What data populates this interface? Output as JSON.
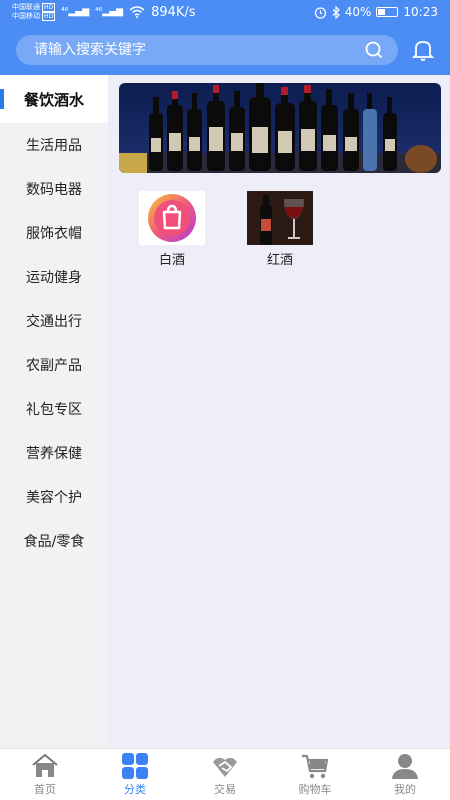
{
  "status": {
    "carrier1": "中国联通",
    "carrier2": "中国移动",
    "hd": "HD",
    "net1": "⁴⁶",
    "net2": "⁴⁶",
    "speed": "894K/s",
    "battery": "40%",
    "battery_level": 0.4,
    "time": "10:23"
  },
  "search": {
    "placeholder": "请输入搜索关键字"
  },
  "sidebar": {
    "items": [
      {
        "label": "餐饮酒水",
        "active": true
      },
      {
        "label": "生活用品"
      },
      {
        "label": "数码电器"
      },
      {
        "label": "服饰衣帽"
      },
      {
        "label": "运动健身"
      },
      {
        "label": "交通出行"
      },
      {
        "label": "农副产品"
      },
      {
        "label": "礼包专区"
      },
      {
        "label": "营养保健"
      },
      {
        "label": "美容个护"
      },
      {
        "label": "食品/零食"
      }
    ]
  },
  "subcategories": [
    {
      "label": "白酒",
      "icon": "shopping-bag-logo-icon"
    },
    {
      "label": "红酒",
      "icon": "red-wine-glass-icon"
    }
  ],
  "tabbar": {
    "items": [
      {
        "label": "首页",
        "icon": "home-icon"
      },
      {
        "label": "分类",
        "icon": "grid-icon",
        "active": true
      },
      {
        "label": "交易",
        "icon": "handshake-icon"
      },
      {
        "label": "购物车",
        "icon": "cart-icon"
      },
      {
        "label": "我的",
        "icon": "user-icon"
      }
    ]
  },
  "colors": {
    "accent": "#4b8df5",
    "active_tab": "#3b82f6",
    "indicator": "#2a7be4"
  }
}
